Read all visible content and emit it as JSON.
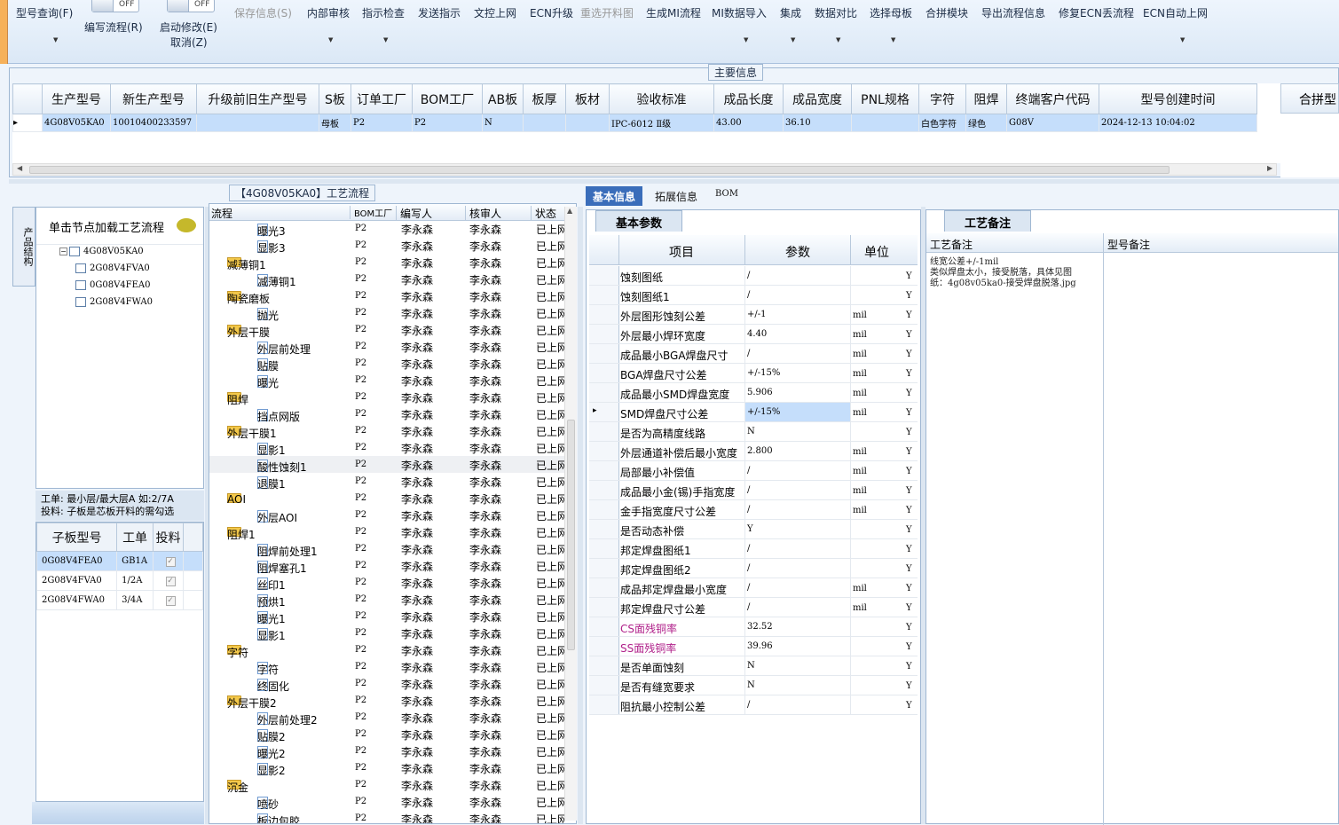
{
  "toolbar": {
    "items": [
      {
        "label": "型号查询(F)",
        "dropdown": true,
        "disabled": false
      },
      {
        "label": "编写流程(R)",
        "dropdown": false,
        "disabled": false,
        "toggle": "OFF"
      },
      {
        "label": "启动修改(E)",
        "sub": "取消(Z)",
        "dropdown": false,
        "disabled": false,
        "toggle": "OFF"
      },
      {
        "label": "保存信息(S)",
        "dropdown": false,
        "disabled": true
      },
      {
        "label": "内部审核",
        "dropdown": true,
        "disabled": false
      },
      {
        "label": "指示检查",
        "dropdown": true,
        "disabled": false
      },
      {
        "label": "发送指示",
        "dropdown": false,
        "disabled": false
      },
      {
        "label": "文控上网",
        "dropdown": false,
        "disabled": false
      },
      {
        "label": "ECN升级",
        "dropdown": false,
        "disabled": false
      },
      {
        "label": "重选开料图",
        "dropdown": false,
        "disabled": true
      },
      {
        "label": "生成MI流程",
        "dropdown": false,
        "disabled": false
      },
      {
        "label": "MI数据导入",
        "dropdown": true,
        "disabled": false
      },
      {
        "label": "集成",
        "dropdown": true,
        "disabled": false
      },
      {
        "label": "数据对比",
        "dropdown": true,
        "disabled": false
      },
      {
        "label": "选择母板",
        "dropdown": true,
        "disabled": false
      },
      {
        "label": "合拼模块",
        "dropdown": false,
        "disabled": false
      },
      {
        "label": "导出流程信息",
        "dropdown": false,
        "disabled": false
      },
      {
        "label": "修复ECN丢流程",
        "dropdown": false,
        "disabled": false
      },
      {
        "label": "ECN自动上网",
        "dropdown": true,
        "disabled": false
      }
    ]
  },
  "main_info": {
    "caption": "主要信息",
    "columns": [
      "生产型号",
      "新生产型号",
      "升级前旧生产型号",
      "S板",
      "订单工厂",
      "BOM工厂",
      "AB板",
      "板厚",
      "板材",
      "验收标准",
      "成品长度",
      "成品宽度",
      "PNL规格",
      "字符",
      "阻焊",
      "终端客户代码",
      "型号创建时间"
    ],
    "rows": [
      [
        "4G08V05KA0",
        "10010400233597",
        "",
        "母板",
        "P2",
        "P2",
        "N",
        "",
        "",
        "IPC-6012 Ⅱ级",
        "43.00",
        "36.10",
        "",
        "白色字符",
        "绿色",
        "G08V",
        "2024-12-13 10:04:02"
      ]
    ],
    "right_header": "合拼型"
  },
  "left": {
    "strip_label": "产品结构",
    "tree_header": "单击节点加载工艺流程",
    "tree": [
      {
        "label": "4G08V05KA0",
        "level": 0
      },
      {
        "label": "2G08V4FVA0",
        "level": 1
      },
      {
        "label": "0G08V4FEA0",
        "level": 1
      },
      {
        "label": "2G08V4FWA0",
        "level": 1
      }
    ],
    "note_line1": "工单: 最小层/最大层A 如:2/7A",
    "note_line2": "投料: 子板是芯板开料的需勾选",
    "sub_columns": [
      "子板型号",
      "工单",
      "投料"
    ],
    "sub_rows": [
      [
        "0G08V4FEA0",
        "GB1A",
        "✓"
      ],
      [
        "2G08V4FVA0",
        "1/2A",
        "✓"
      ],
      [
        "2G08V4FWA0",
        "3/4A",
        "✓"
      ]
    ]
  },
  "process": {
    "title": "【4G08V05KA0】工艺流程",
    "columns": [
      "流程",
      "BOM工厂",
      "编写人",
      "核审人",
      "状态"
    ],
    "rows": [
      {
        "name": "曝光3",
        "type": "doc",
        "bom": "P2",
        "writer": "李永森",
        "reviewer": "李永森",
        "status": "已上网"
      },
      {
        "name": "显影3",
        "type": "doc",
        "bom": "P2",
        "writer": "李永森",
        "reviewer": "李永森",
        "status": "已上网"
      },
      {
        "name": "减薄铜1",
        "type": "folder",
        "bom": "P2",
        "writer": "李永森",
        "reviewer": "李永森",
        "status": "已上网"
      },
      {
        "name": "减薄铜1",
        "type": "doc",
        "bom": "P2",
        "writer": "李永森",
        "reviewer": "李永森",
        "status": "已上网"
      },
      {
        "name": "陶瓷磨板",
        "type": "folder",
        "bom": "P2",
        "writer": "李永森",
        "reviewer": "李永森",
        "status": "已上网"
      },
      {
        "name": "抛光",
        "type": "doc",
        "bom": "P2",
        "writer": "李永森",
        "reviewer": "李永森",
        "status": "已上网"
      },
      {
        "name": "外层干膜",
        "type": "folder",
        "bom": "P2",
        "writer": "李永森",
        "reviewer": "李永森",
        "status": "已上网"
      },
      {
        "name": "外层前处理",
        "type": "doc",
        "bom": "P2",
        "writer": "李永森",
        "reviewer": "李永森",
        "status": "已上网"
      },
      {
        "name": "贴膜",
        "type": "doc",
        "bom": "P2",
        "writer": "李永森",
        "reviewer": "李永森",
        "status": "已上网"
      },
      {
        "name": "曝光",
        "type": "doc",
        "bom": "P2",
        "writer": "李永森",
        "reviewer": "李永森",
        "status": "已上网"
      },
      {
        "name": "阻焊",
        "type": "folder",
        "bom": "P2",
        "writer": "李永森",
        "reviewer": "李永森",
        "status": "已上网"
      },
      {
        "name": "挡点网版",
        "type": "doc",
        "bom": "P2",
        "writer": "李永森",
        "reviewer": "李永森",
        "status": "已上网"
      },
      {
        "name": "外层干膜1",
        "type": "folder",
        "bom": "P2",
        "writer": "李永森",
        "reviewer": "李永森",
        "status": "已上网"
      },
      {
        "name": "显影1",
        "type": "doc",
        "bom": "P2",
        "writer": "李永森",
        "reviewer": "李永森",
        "status": "已上网"
      },
      {
        "name": "酸性蚀刻1",
        "type": "doc",
        "bom": "P2",
        "writer": "李永森",
        "reviewer": "李永森",
        "status": "已上网",
        "hover": true
      },
      {
        "name": "退膜1",
        "type": "doc",
        "bom": "P2",
        "writer": "李永森",
        "reviewer": "李永森",
        "status": "已上网"
      },
      {
        "name": "AOI",
        "type": "folder",
        "bom": "P2",
        "writer": "李永森",
        "reviewer": "李永森",
        "status": "已上网"
      },
      {
        "name": "外层AOI",
        "type": "doc",
        "bom": "P2",
        "writer": "李永森",
        "reviewer": "李永森",
        "status": "已上网"
      },
      {
        "name": "阻焊1",
        "type": "folder",
        "bom": "P2",
        "writer": "李永森",
        "reviewer": "李永森",
        "status": "已上网"
      },
      {
        "name": "阻焊前处理1",
        "type": "doc",
        "bom": "P2",
        "writer": "李永森",
        "reviewer": "李永森",
        "status": "已上网"
      },
      {
        "name": "阻焊塞孔1",
        "type": "doc",
        "bom": "P2",
        "writer": "李永森",
        "reviewer": "李永森",
        "status": "已上网"
      },
      {
        "name": "丝印1",
        "type": "doc",
        "bom": "P2",
        "writer": "李永森",
        "reviewer": "李永森",
        "status": "已上网"
      },
      {
        "name": "预烘1",
        "type": "doc",
        "bom": "P2",
        "writer": "李永森",
        "reviewer": "李永森",
        "status": "已上网"
      },
      {
        "name": "曝光1",
        "type": "doc",
        "bom": "P2",
        "writer": "李永森",
        "reviewer": "李永森",
        "status": "已上网"
      },
      {
        "name": "显影1",
        "type": "doc",
        "bom": "P2",
        "writer": "李永森",
        "reviewer": "李永森",
        "status": "已上网"
      },
      {
        "name": "字符",
        "type": "folder",
        "bom": "P2",
        "writer": "李永森",
        "reviewer": "李永森",
        "status": "已上网"
      },
      {
        "name": "字符",
        "type": "doc",
        "bom": "P2",
        "writer": "李永森",
        "reviewer": "李永森",
        "status": "已上网"
      },
      {
        "name": "终固化",
        "type": "doc",
        "bom": "P2",
        "writer": "李永森",
        "reviewer": "李永森",
        "status": "已上网"
      },
      {
        "name": "外层干膜2",
        "type": "folder",
        "bom": "P2",
        "writer": "李永森",
        "reviewer": "李永森",
        "status": "已上网"
      },
      {
        "name": "外层前处理2",
        "type": "doc",
        "bom": "P2",
        "writer": "李永森",
        "reviewer": "李永森",
        "status": "已上网"
      },
      {
        "name": "贴膜2",
        "type": "doc",
        "bom": "P2",
        "writer": "李永森",
        "reviewer": "李永森",
        "status": "已上网"
      },
      {
        "name": "曝光2",
        "type": "doc",
        "bom": "P2",
        "writer": "李永森",
        "reviewer": "李永森",
        "status": "已上网"
      },
      {
        "name": "显影2",
        "type": "doc",
        "bom": "P2",
        "writer": "李永森",
        "reviewer": "李永森",
        "status": "已上网"
      },
      {
        "name": "沉金",
        "type": "folder",
        "bom": "P2",
        "writer": "李永森",
        "reviewer": "李永森",
        "status": "已上网"
      },
      {
        "name": "喷砂",
        "type": "doc",
        "bom": "P2",
        "writer": "李永森",
        "reviewer": "李永森",
        "status": "已上网"
      },
      {
        "name": "板边包胶",
        "type": "doc",
        "bom": "P2",
        "writer": "李永森",
        "reviewer": "李永森",
        "status": "已上网"
      }
    ]
  },
  "detail": {
    "tabs": [
      "基本信息",
      "拓展信息",
      "BOM"
    ],
    "section": "基本参数",
    "columns": [
      "项目",
      "参数",
      "单位"
    ],
    "rows": [
      {
        "item": "蚀刻图纸",
        "param": "/",
        "unit": "",
        "flag": "Y"
      },
      {
        "item": "蚀刻图纸1",
        "param": "/",
        "unit": "",
        "flag": "Y"
      },
      {
        "item": "外层图形蚀刻公差",
        "param": "+/-1",
        "unit": "mil",
        "flag": "Y"
      },
      {
        "item": "外层最小焊环宽度",
        "param": "4.40",
        "unit": "mil",
        "flag": "Y"
      },
      {
        "item": "成品最小BGA焊盘尺寸",
        "param": "/",
        "unit": "mil",
        "flag": "Y"
      },
      {
        "item": "BGA焊盘尺寸公差",
        "param": "+/-15%",
        "unit": "mil",
        "flag": "Y"
      },
      {
        "item": "成品最小SMD焊盘宽度",
        "param": "5.906",
        "unit": "mil",
        "flag": "Y"
      },
      {
        "item": "SMD焊盘尺寸公差",
        "param": "+/-15%",
        "unit": "mil",
        "flag": "Y",
        "selected": true
      },
      {
        "item": "是否为高精度线路",
        "param": "N",
        "unit": "",
        "flag": "Y"
      },
      {
        "item": "外层通道补偿后最小宽度",
        "param": "2.800",
        "unit": "mil",
        "flag": "Y"
      },
      {
        "item": "局部最小补偿值",
        "param": "/",
        "unit": "mil",
        "flag": "Y"
      },
      {
        "item": "成品最小金(锡)手指宽度",
        "param": "/",
        "unit": "mil",
        "flag": "Y"
      },
      {
        "item": "金手指宽度尺寸公差",
        "param": "/",
        "unit": "mil",
        "flag": "Y"
      },
      {
        "item": "是否动态补偿",
        "param": "Y",
        "unit": "",
        "flag": "Y"
      },
      {
        "item": "邦定焊盘图纸1",
        "param": "/",
        "unit": "",
        "flag": "Y"
      },
      {
        "item": "邦定焊盘图纸2",
        "param": "/",
        "unit": "",
        "flag": "Y"
      },
      {
        "item": "成品邦定焊盘最小宽度",
        "param": "/",
        "unit": "mil",
        "flag": "Y"
      },
      {
        "item": "邦定焊盘尺寸公差",
        "param": "/",
        "unit": "mil",
        "flag": "Y"
      },
      {
        "item": "CS面残铜率",
        "param": "32.52",
        "unit": "",
        "flag": "Y",
        "magenta": true
      },
      {
        "item": "SS面残铜率",
        "param": "39.96",
        "unit": "",
        "flag": "Y",
        "magenta": true
      },
      {
        "item": "是否单面蚀刻",
        "param": "N",
        "unit": "",
        "flag": "Y"
      },
      {
        "item": "是否有缝宽要求",
        "param": "N",
        "unit": "",
        "flag": "Y"
      },
      {
        "item": "阻抗最小控制公差",
        "param": "/",
        "unit": "",
        "flag": "Y"
      }
    ]
  },
  "notes": {
    "section": "工艺备注",
    "col1": "工艺备注",
    "col2": "型号备注",
    "text": "线宽公差+/-1mil\n类似焊盘太小，接受脱落，具体见图纸：4g08v05ka0-接受焊盘脱落.jpg"
  },
  "colors": {
    "accent": "#3a6dba",
    "selected": "#c5defb",
    "magenta": "#b0208a",
    "toolbar_left": "#f6b15a"
  }
}
